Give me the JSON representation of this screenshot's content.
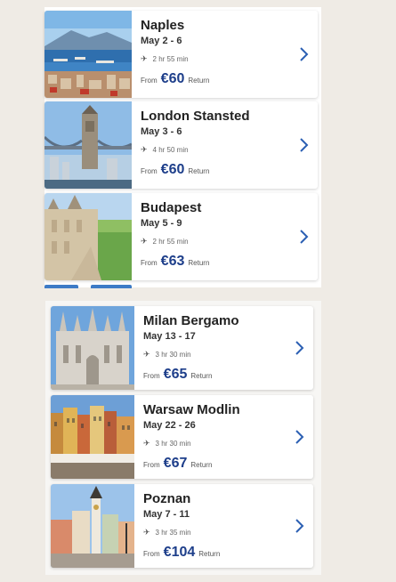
{
  "common": {
    "from_label": "From",
    "return_label": "Return",
    "plane_glyph": "✈"
  },
  "colors": {
    "price": "#1d3e8a",
    "chevron": "#2b5fb3",
    "background": "#efebe5"
  },
  "group1": [
    {
      "destination": "Naples",
      "dates": "May 2 - 6",
      "duration": "2 hr 55 min",
      "price": "€60",
      "image": "naples-harbour-photo"
    },
    {
      "destination": "London Stansted",
      "dates": "May 3 - 6",
      "duration": "4 hr 50 min",
      "price": "€60",
      "image": "tower-bridge-photo"
    },
    {
      "destination": "Budapest",
      "dates": "May 5 - 9",
      "duration": "2 hr 55 min",
      "price": "€63",
      "image": "fishermans-bastion-photo"
    }
  ],
  "group2": [
    {
      "destination": "Milan Bergamo",
      "dates": "May 13 - 17",
      "duration": "3 hr 30 min",
      "price": "€65",
      "image": "milan-cathedral-photo"
    },
    {
      "destination": "Warsaw Modlin",
      "dates": "May 22 - 26",
      "duration": "3 hr 30 min",
      "price": "€67",
      "image": "warsaw-old-town-photo"
    },
    {
      "destination": "Poznan",
      "dates": "May 7 - 11",
      "duration": "3 hr 35 min",
      "price": "€104",
      "image": "poznan-town-hall-photo"
    }
  ]
}
